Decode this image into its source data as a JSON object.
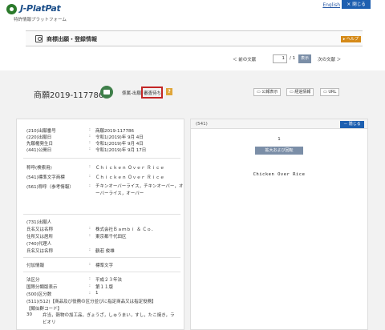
{
  "header": {
    "logo_text": "J-PlatPat",
    "logo_sub": "特許情報プラットフォーム",
    "lang_link": "English",
    "close_label": "閉じる",
    "close_icon": "×"
  },
  "title_band": {
    "title": "商標出願・登録情報",
    "help": "ヘルプ"
  },
  "pager": {
    "prev": "＜ 前の文献",
    "current": "1",
    "total": "/ 1",
    "show": "表示",
    "next": "次の文献 ＞"
  },
  "record": {
    "app_no": "商願2019-117786",
    "status_label": "係属-出願",
    "status_value": "審査待ち",
    "question_icon": "?",
    "buttons": [
      "公報表示",
      "経過情報",
      "URL"
    ]
  },
  "details": {
    "colon": ":",
    "rows1": [
      {
        "label": "(210)出願番号",
        "value": "商願2019-117786"
      },
      {
        "label": "(220)出願日",
        "value": "令和1(2019)年 9月 4日"
      },
      {
        "label": "先願権発生日",
        "value": "令和1(2019)年 9月 4日"
      },
      {
        "label": "(441)公開日",
        "value": "令和1(2019)年 9月 17日"
      }
    ],
    "rows2": [
      {
        "label": "称呼(検索用)",
        "value": "Ｃｈｉｃｋｅｎ Ｏｖｅｒ Ｒｉｃｅ"
      },
      {
        "label": "(541)標準文字商標",
        "value": "Ｃｈｉｃｋｅｎ Ｏｖｅｒ Ｒｉｃｅ"
      }
    ],
    "call_label": "(561)称呼（参考情報）",
    "call_value": "チキンオーバーライス，チキンオーバー，オーバーライス，オーバー",
    "applicant_head": "(731)出願人",
    "rows3": [
      {
        "label": "氏名又は名称",
        "value": "株式会社Ｂａｍｂｉ ＆ Ｃｏ．"
      },
      {
        "label": "住所又は居所",
        "value": "東京都千代田区"
      }
    ],
    "agent_head": "(740)代理人",
    "agent_row": {
      "label": "氏名又は名称",
      "value": "鶴若 俊雄"
    },
    "info_row": {
      "label": "付加情報",
      "value": "標準文字"
    },
    "rows4": [
      {
        "label": "法区分",
        "value": "平成２３年法"
      },
      {
        "label": "国際分類版表示",
        "value": "第１１版"
      },
      {
        "label": "(500)区分数",
        "value": "1"
      }
    ],
    "goods_head": "(511)(512)【商品及び役務の区分並びに指定商品又は指定役務】",
    "class_code": "【類似群コード】",
    "class_no": "30",
    "class_text1": "弁当，穀物の加工品，ぎょうざ，しゅうまい，すし，たこ焼き，ラビオリ"
  },
  "image_panel": {
    "label": "(541)",
    "hide": "－ 隠じる",
    "page": "1",
    "zoom": "拡大および回転",
    "mark": "Chicken Over Rice"
  }
}
